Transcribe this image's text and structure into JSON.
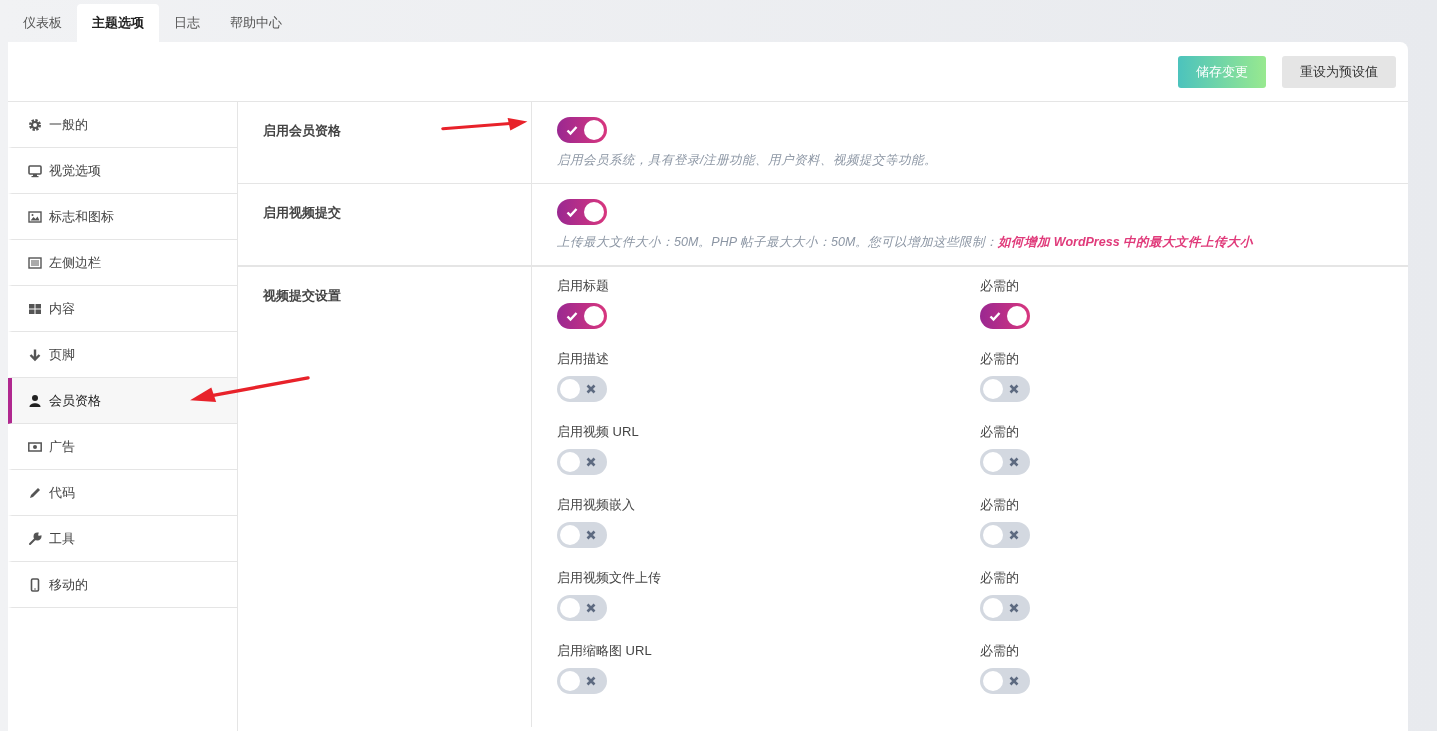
{
  "tabs": [
    {
      "label": "仪表板",
      "selected": false
    },
    {
      "label": "主题选项",
      "selected": true
    },
    {
      "label": "日志",
      "selected": false
    },
    {
      "label": "帮助中心",
      "selected": false
    }
  ],
  "buttons": [
    {
      "label": "储存变更",
      "kind": "primary"
    },
    {
      "label": "重设为预设值",
      "kind": "secondary"
    }
  ],
  "sidebar": {
    "items": [
      {
        "label": "一般的",
        "selected": false
      },
      {
        "label": "视觉选项",
        "selected": false
      },
      {
        "label": "标志和图标",
        "selected": false
      },
      {
        "label": "左侧边栏",
        "selected": false
      },
      {
        "label": "内容",
        "selected": false
      },
      {
        "label": "页脚",
        "selected": false
      },
      {
        "label": "会员资格",
        "selected": true
      },
      {
        "label": "广告",
        "selected": false
      },
      {
        "label": "代码",
        "selected": false
      },
      {
        "label": "工具",
        "selected": false
      },
      {
        "label": "移动的",
        "selected": false
      }
    ]
  },
  "settings": [
    {
      "kind": "single",
      "label": "启用会员资格",
      "on": true,
      "description": "启用会员系统，具有登录/注册功能、用户资料、视频提交等功能。"
    },
    {
      "kind": "single",
      "label": "启用视频提交",
      "on": true,
      "description": "上传最大文件大小：50M。PHP 帖子最大大小：50M。您可以增加这些限制：",
      "link": "如何增加 WordPress 中的最大文件上传大小"
    },
    {
      "kind": "grid",
      "label": "视频提交设置",
      "fields": [
        {
          "label": "启用标题",
          "on": true
        },
        {
          "label": "必需的",
          "on": true
        },
        {
          "label": "启用描述",
          "on": false
        },
        {
          "label": "必需的",
          "on": false
        },
        {
          "label": "启用视频 URL",
          "on": false
        },
        {
          "label": "必需的",
          "on": false
        },
        {
          "label": "启用视频嵌入",
          "on": false
        },
        {
          "label": "必需的",
          "on": false
        },
        {
          "label": "启用视频文件上传",
          "on": false
        },
        {
          "label": "必需的",
          "on": false
        },
        {
          "label": "启用缩略图 URL",
          "on": false
        },
        {
          "label": "必需的",
          "on": false
        }
      ]
    }
  ]
}
